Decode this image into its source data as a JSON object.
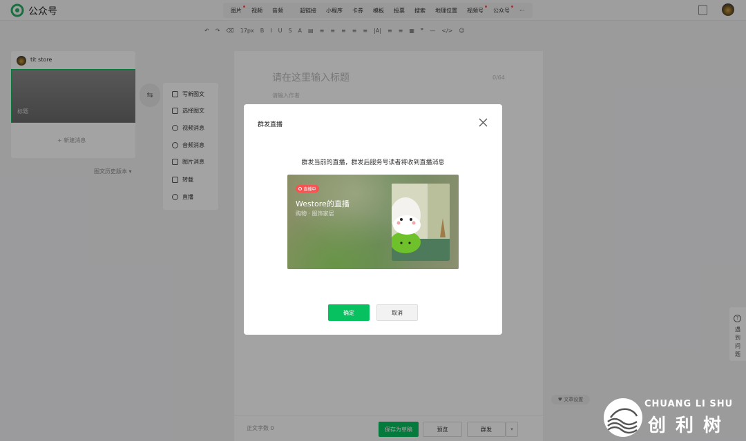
{
  "app": {
    "brand": "公众号"
  },
  "top_menu": [
    {
      "label": "图片",
      "dot": true
    },
    {
      "label": "视频",
      "dot": false
    },
    {
      "label": "音频",
      "dot": false
    },
    {
      "label": "超链接",
      "dot": false
    },
    {
      "label": "小程序",
      "dot": false
    },
    {
      "label": "卡券",
      "dot": false
    },
    {
      "label": "模板",
      "dot": false
    },
    {
      "label": "投票",
      "dot": false
    },
    {
      "label": "搜索",
      "dot": false
    },
    {
      "label": "地理位置",
      "dot": false
    },
    {
      "label": "视频号",
      "dot": true
    },
    {
      "label": "公众号",
      "dot": true
    },
    {
      "label": "···",
      "dot": false
    }
  ],
  "format_toolbar": {
    "font_size": "17px",
    "items": [
      "↶",
      "↷",
      "⌫",
      "17px",
      "B",
      "I",
      "U",
      "S",
      "A",
      "▤",
      "≡",
      "≡",
      "≡",
      "≡",
      "≡",
      "|A|",
      "≡",
      "≡",
      "▦",
      "❞",
      "—",
      "</>",
      "☺"
    ]
  },
  "sidebar": {
    "account_name": "tit store",
    "cover_label": "标题",
    "new_message": "+ 新建消息",
    "history": "图文历史版本 ▾"
  },
  "insert_menu": [
    {
      "label": "写新图文",
      "icon": "new-article-icon"
    },
    {
      "label": "选择图文",
      "icon": "select-article-icon"
    },
    {
      "label": "视频消息",
      "icon": "video-icon"
    },
    {
      "label": "音频消息",
      "icon": "audio-icon"
    },
    {
      "label": "图片消息",
      "icon": "image-icon"
    },
    {
      "label": "转载",
      "icon": "repost-icon"
    },
    {
      "label": "直播",
      "icon": "live-icon"
    }
  ],
  "editor": {
    "title_placeholder": "请在这里输入标题",
    "title_count": "0/64",
    "author_placeholder": "请输入作者",
    "word_count": "正文字数 0"
  },
  "bottom_actions": {
    "save_draft": "保存为草稿",
    "preview": "预览",
    "mass_send": "群发",
    "arrow": "▾"
  },
  "help": {
    "label": "遇到问题"
  },
  "article_settings": "♥ 文章设置",
  "modal": {
    "title": "群发直播",
    "description": "群发当前的直播，群发后服务号读者将收到直播消息",
    "live_badge": "直播中",
    "live_name": "Westore的直播",
    "live_category": "购物 · 服饰家居",
    "confirm": "确定",
    "cancel": "取消"
  },
  "watermark": {
    "en": "CHUANG LI SHU",
    "cn": "创利树"
  },
  "colors": {
    "accent": "#07c160",
    "live_red": "#fa5151"
  }
}
